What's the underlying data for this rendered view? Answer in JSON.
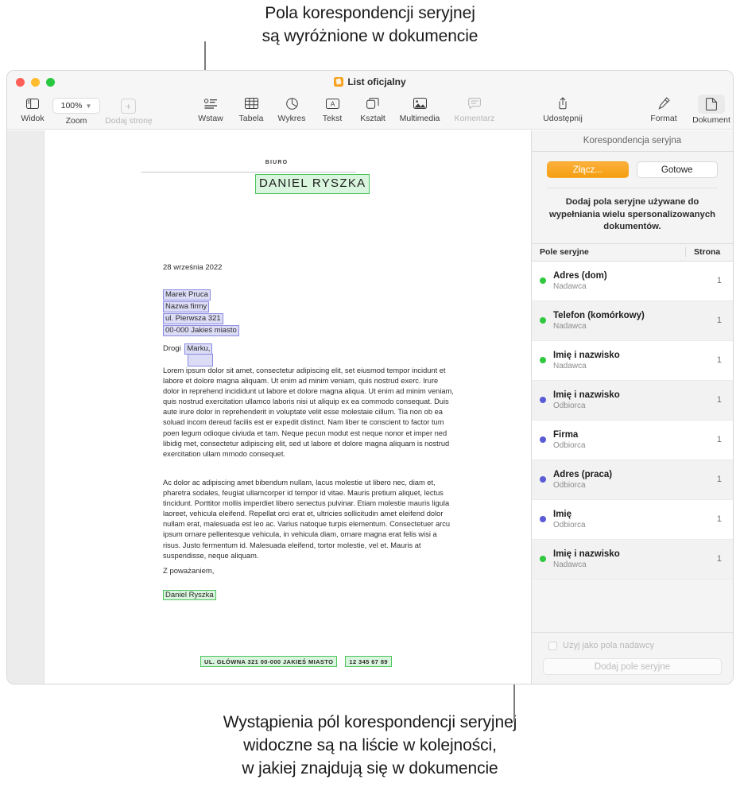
{
  "captions": {
    "top": "Pola korespondencji seryjnej\nsą wyróżnione w dokumencie",
    "bottom": "Wystąpienia pól korespondencji seryjnej\nwidoczne są na liście w kolejności,\nw jakiej znajdują się w dokumencie"
  },
  "window": {
    "title": "List oficjalny"
  },
  "toolbar": {
    "view_label": "Widok",
    "zoom_value": "100%",
    "zoom_label": "Zoom",
    "add_page_label": "Dodaj stronę",
    "insert_label": "Wstaw",
    "table_label": "Tabela",
    "chart_label": "Wykres",
    "text_label": "Tekst",
    "shape_label": "Kształt",
    "media_label": "Multimedia",
    "comment_label": "Komentarz",
    "share_label": "Udostępnij",
    "format_label": "Format",
    "document_label": "Dokument"
  },
  "document": {
    "header_kicker": "BIURO",
    "header_name": "DANIEL RYSZKA",
    "date": "28 września 2022",
    "address": [
      "Marek Pruca",
      "Nazwa firmy",
      "ul. Pierwsza 321",
      "00-000 Jakieś miasto"
    ],
    "greeting_prefix": "Drogi ",
    "greeting_field": "Marku,",
    "paragraph1": "Lorem ipsum dolor sit amet, consectetur adipiscing elit, set eiusmod tempor incidunt et labore et dolore magna aliquam. Ut enim ad minim veniam, quis nostrud exerc. Irure dolor in reprehend incididunt ut labore et dolore magna aliqua. Ut enim ad minim veniam, quis nostrud exercitation ullamco laboris nisi ut aliquip ex ea commodo consequat. Duis aute irure dolor in reprehenderit in voluptate velit esse molestaie cillum. Tia non ob ea soluad incom dereud facilis est er expedit distinct. Nam liber te conscient to factor tum poen legum odioque civiuda et tam. Neque pecun modut est neque nonor et imper ned libidig met, consectetur adipiscing elit, sed ut labore et dolore magna aliquam is nostrud exercitation ullam mmodo consequet.",
    "paragraph2": "Ac dolor ac adipiscing amet bibendum nullam, lacus molestie ut libero nec, diam et, pharetra sodales, feugiat ullamcorper id tempor id vitae. Mauris pretium aliquet, lectus tincidunt. Porttitor mollis imperdiet libero senectus pulvinar. Etiam molestie mauris ligula laoreet, vehicula eleifend. Repellat orci erat et, ultricies sollicitudin amet eleifend dolor nullam erat, malesuada est leo ac. Varius natoque turpis elementum. Consectetuer arcu ipsum ornare pellentesque vehicula, in vehicula diam, ornare magna erat felis wisi a risus. Justo fermentum id. Malesuada eleifend, tortor molestie, vel et. Mauris at suspendisse, neque aliquam.",
    "closing": "Z poważaniem,",
    "signature": "Daniel Ryszka",
    "footer_address": "UL. GŁÓWNA 321   00-000 JAKIEŚ MIASTO",
    "footer_phone": "12 345 67 89"
  },
  "inspector": {
    "title": "Korespondencja seryjna",
    "merge_button": "Złącz...",
    "done_button": "Gotowe",
    "description": "Dodaj pola seryjne używane do wypełniania wielu spersonalizowanych dokumentów.",
    "col_field": "Pole seryjne",
    "col_page": "Strona",
    "fields": [
      {
        "name": "Adres (dom)",
        "role": "Nadawca",
        "page": "1",
        "color": "#2fc83f"
      },
      {
        "name": "Telefon (komórkowy)",
        "role": "Nadawca",
        "page": "1",
        "color": "#2fc83f"
      },
      {
        "name": "Imię i nazwisko",
        "role": "Nadawca",
        "page": "1",
        "color": "#2fc83f"
      },
      {
        "name": "Imię i nazwisko",
        "role": "Odbiorca",
        "page": "1",
        "color": "#5b5bd6"
      },
      {
        "name": "Firma",
        "role": "Odbiorca",
        "page": "1",
        "color": "#5b5bd6"
      },
      {
        "name": "Adres (praca)",
        "role": "Odbiorca",
        "page": "1",
        "color": "#5b5bd6"
      },
      {
        "name": "Imię",
        "role": "Odbiorca",
        "page": "1",
        "color": "#5b5bd6"
      },
      {
        "name": "Imię i nazwisko",
        "role": "Nadawca",
        "page": "1",
        "color": "#2fc83f"
      }
    ],
    "use_as_sender_checkbox": "Użyj jako pola nadawcy",
    "add_field_button": "Dodaj pole seryjne"
  },
  "colors": {
    "accent": "#f5a21f",
    "sender_dot": "#2fc83f",
    "recipient_dot": "#5b5bd6",
    "sender_highlight": "#d9f5dd",
    "recipient_highlight": "#dcdcf7"
  }
}
